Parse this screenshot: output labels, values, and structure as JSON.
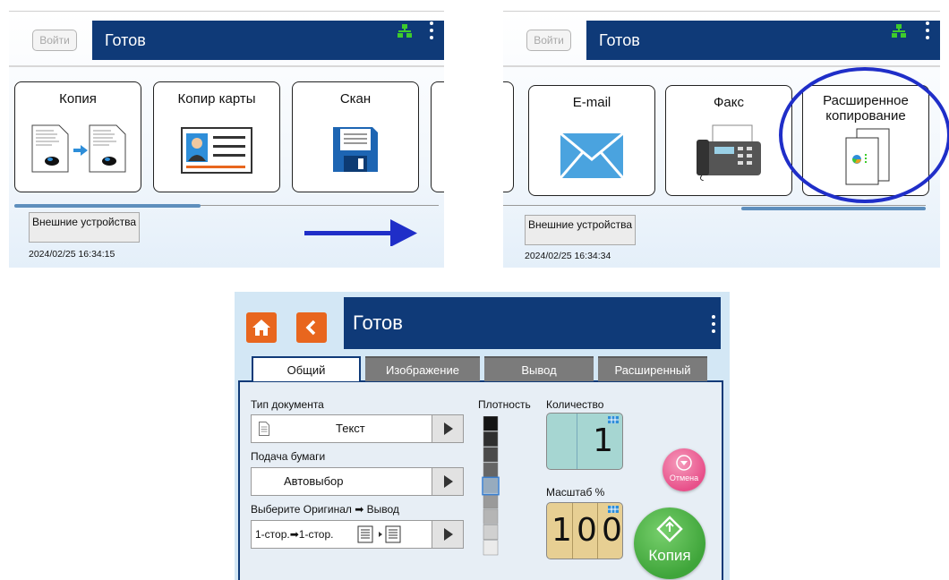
{
  "screen1": {
    "login_label": "Войти",
    "status": "Готов",
    "tiles": [
      {
        "label": "Копия"
      },
      {
        "label": "Копир карты"
      },
      {
        "label": "Скан"
      }
    ],
    "external_label": "Внешние устройства",
    "datetime": "2024/02/25 16:34:15"
  },
  "screen2": {
    "login_label": "Войти",
    "status": "Готов",
    "tiles": [
      {
        "label": "E-mail"
      },
      {
        "label": "Факс"
      },
      {
        "label": "Расширенное копирование"
      }
    ],
    "external_label": "Внешние устройства",
    "datetime": "2024/02/25 16:34:34"
  },
  "screen3": {
    "status": "Готов",
    "tabs": [
      {
        "label": "Общий",
        "active": true
      },
      {
        "label": "Изображение"
      },
      {
        "label": "Вывод"
      },
      {
        "label": "Расширенный"
      }
    ],
    "doc_type_label": "Тип документа",
    "doc_type_value": "Текст",
    "paper_label": "Подача бумаги",
    "paper_value": "Автовыбор",
    "orig_label": "Выберите Оригинал ➡ Вывод",
    "orig_value": "1-стор.➡1-стор.",
    "density_label": "Плотность",
    "density_level": 5,
    "density_steps": 9,
    "quantity_label": "Количество",
    "quantity_value": "1",
    "scale_label": "Масштаб %",
    "scale_digits": [
      "1",
      "0",
      "0"
    ],
    "cancel_label": "Отмена",
    "copy_label": "Копия"
  },
  "colors": {
    "header": "#0f3a78",
    "accent_orange": "#e8661e",
    "start_green": "#3fa53a",
    "cancel_pink": "#e8508a",
    "annotation": "#1f2ec8"
  },
  "icons": [
    "network-icon",
    "menu-dots-icon",
    "copy-icon",
    "id-card-icon",
    "floppy-disk-icon",
    "envelope-icon",
    "fax-icon",
    "advanced-copy-icon",
    "home-icon",
    "back-icon",
    "text-doc-icon",
    "duplex-icon",
    "start-icon",
    "cancel-icon"
  ]
}
